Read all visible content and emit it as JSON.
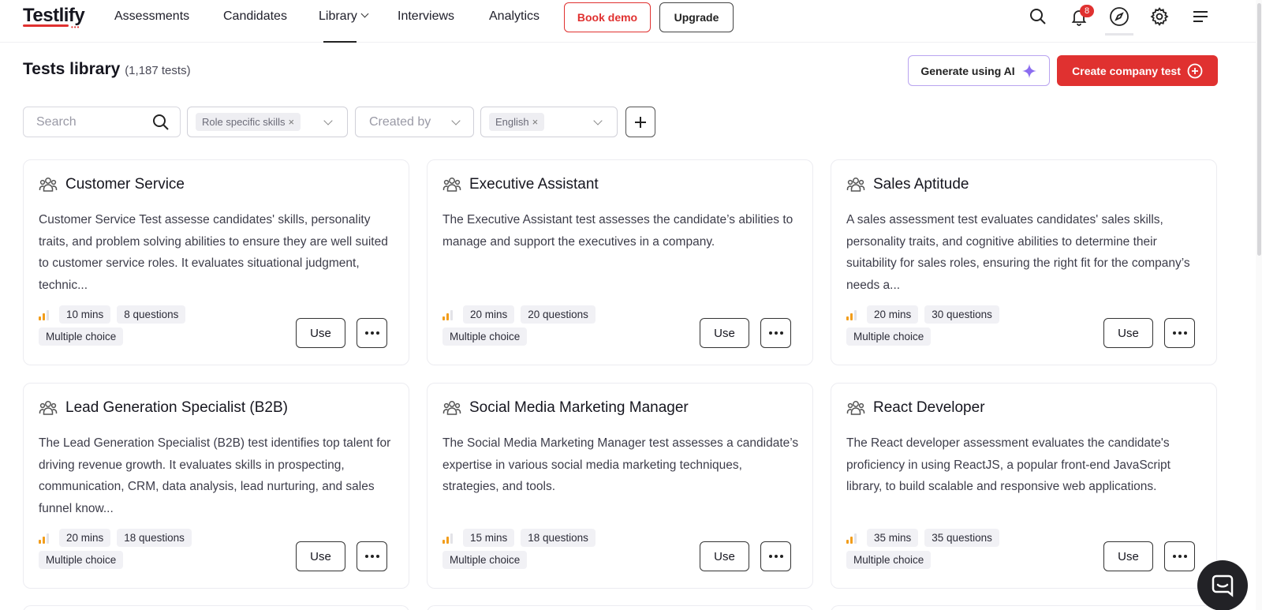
{
  "nav": {
    "logo": "Testlify",
    "items": [
      "Assessments",
      "Candidates",
      "Library",
      "Interviews",
      "Analytics"
    ],
    "book_demo": "Book demo",
    "upgrade": "Upgrade",
    "notification_count": "8",
    "icons": [
      "search-icon",
      "bell-icon",
      "compass-icon",
      "gear-icon",
      "menu-icon"
    ]
  },
  "header": {
    "title": "Tests library",
    "count": "(1,187 tests)",
    "generate_ai": "Generate using AI",
    "create_test": "Create company test"
  },
  "filters": {
    "search_placeholder": "Search",
    "type_chip": "Role specific skills",
    "created_by_placeholder": "Created by",
    "language_chip": "English"
  },
  "cards": [
    {
      "title": "Customer Service",
      "description": "Customer Service Test assesse candidates' skills, personality traits, and problem solving abilities to ensure they are well suited to customer service roles. It evaluates situational judgment, technic...",
      "duration": "10 mins",
      "questions": "8 questions",
      "type": "Multiple choice",
      "use": "Use"
    },
    {
      "title": "Executive Assistant",
      "description": "The Executive Assistant test assesses the candidate’s abilities to manage and support the executives in a company.",
      "duration": "20 mins",
      "questions": "20 questions",
      "type": "Multiple choice",
      "use": "Use"
    },
    {
      "title": "Sales Aptitude",
      "description": "A sales assessment test evaluates candidates' sales skills, personality traits, and cognitive abilities to determine their suitability for sales roles, ensuring the right fit for the company’s needs a...",
      "duration": "20 mins",
      "questions": "30 questions",
      "type": "Multiple choice",
      "use": "Use"
    },
    {
      "title": "Lead Generation Specialist (B2B)",
      "description": "The Lead Generation Specialist (B2B) test identifies top talent for driving revenue growth. It evaluates skills in prospecting, communication, CRM, data analysis, lead nurturing, and sales funnel know...",
      "duration": "20 mins",
      "questions": "18 questions",
      "type": "Multiple choice",
      "use": "Use"
    },
    {
      "title": "Social Media Marketing Manager",
      "description": "The Social Media Marketing Manager test assesses a candidate’s expertise in various social media marketing techniques, strategies, and tools.",
      "duration": "15 mins",
      "questions": "18 questions",
      "type": "Multiple choice",
      "use": "Use"
    },
    {
      "title": "React Developer",
      "description": "The React developer assessment evaluates the candidate's proficiency in using ReactJS, a popular front-end JavaScript library, to build scalable and responsive web applications.",
      "duration": "35 mins",
      "questions": "35 questions",
      "type": "Multiple choice",
      "use": "Use"
    }
  ],
  "colors": {
    "brand_red": "#e03130",
    "ai_purple": "#8b6cf0",
    "level_orange": "#f29d1b"
  }
}
